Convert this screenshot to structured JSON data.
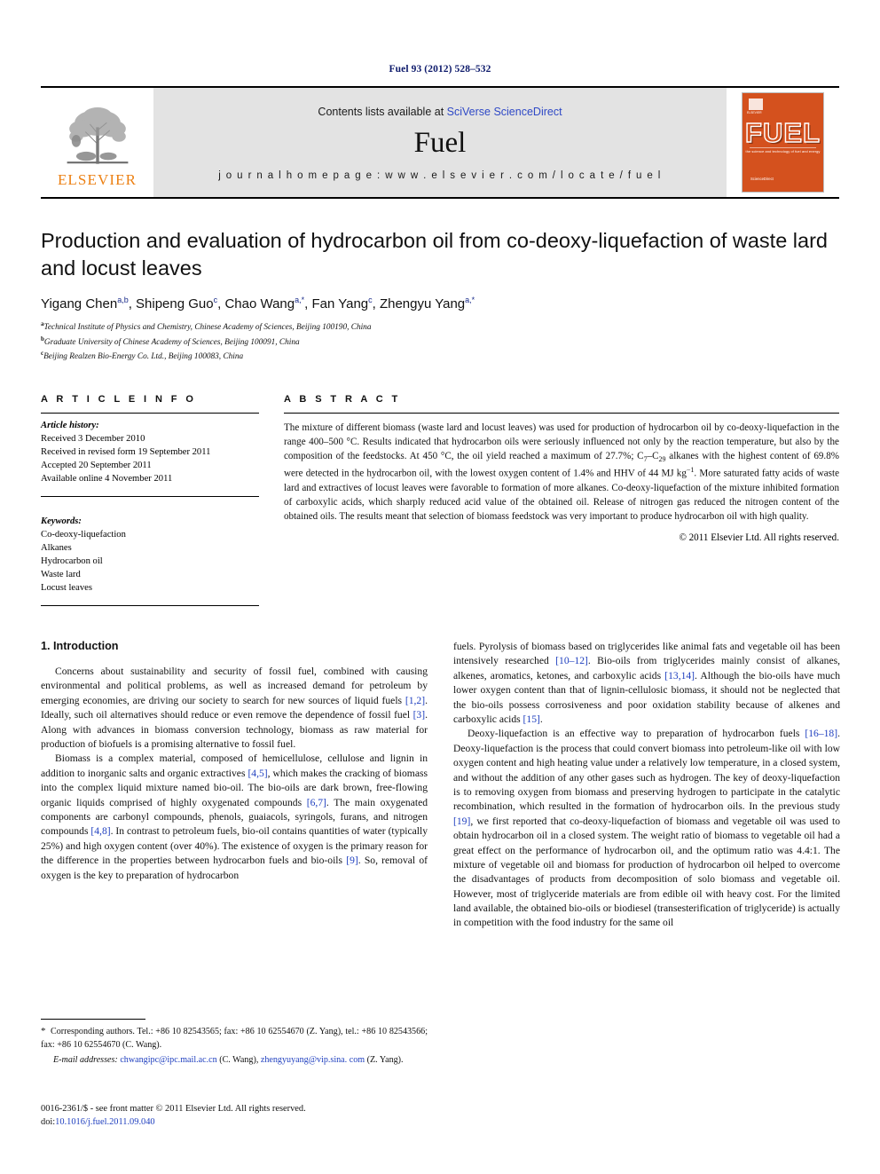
{
  "running_head": "Fuel 93 (2012) 528–532",
  "masthead": {
    "publisher_name": "ELSEVIER",
    "contents_prefix": "Contents lists available at ",
    "contents_link": "SciVerse ScienceDirect",
    "journal_name": "Fuel",
    "homepage": "j o u r n a l   h o m e p a g e :   w w w . e l s e v i e r . c o m / l o c a t e / f u e l",
    "cover": {
      "word": "FUEL",
      "subtitle": "the science and technology of fuel and energy",
      "footer": "ScienceDirect",
      "els_label": "ELSEVIER",
      "color": "#d4511e"
    }
  },
  "article": {
    "title": "Production and evaluation of hydrocarbon oil from co-deoxy-liquefaction of waste lard and locust leaves",
    "authors_html": "Yigang Chen<sup>a,b</sup>, Shipeng Guo<sup>c</sup>, Chao Wang<sup>a,*</sup>, Fan Yang<sup>c</sup>, Zhengyu Yang<sup>a,*</sup>",
    "affiliations": [
      {
        "marker": "a",
        "text": "Technical Institute of Physics and Chemistry, Chinese Academy of Sciences, Beijing 100190, China"
      },
      {
        "marker": "b",
        "text": "Graduate University of Chinese Academy of Sciences, Beijing 100091, China"
      },
      {
        "marker": "c",
        "text": "Beijing Realzen Bio-Energy Co. Ltd., Beijing 100083, China"
      }
    ]
  },
  "article_info": {
    "heading": "A R T I C L E   I N F O",
    "history_label": "Article history:",
    "history": [
      "Received 3 December 2010",
      "Received in revised form 19 September 2011",
      "Accepted 20 September 2011",
      "Available online 4 November 2011"
    ],
    "keywords_label": "Keywords:",
    "keywords": [
      "Co-deoxy-liquefaction",
      "Alkanes",
      "Hydrocarbon oil",
      "Waste lard",
      "Locust leaves"
    ]
  },
  "abstract": {
    "heading": "A B S T R A C T",
    "text_html": "The mixture of different biomass (waste lard and locust leaves) was used for production of hydrocarbon oil by co-deoxy-liquefaction in the range 400–500 °C. Results indicated that hydrocarbon oils were seriously influenced not only by the reaction temperature, but also by the composition of the feedstocks. At 450 °C, the oil yield reached a maximum of 27.7%; C<sub>7</sub>–C<sub>29</sub> alkanes with the highest content of 69.8% were detected in the hydrocarbon oil, with the lowest oxygen content of 1.4% and HHV of 44 MJ kg<sup>−1</sup>. More saturated fatty acids of waste lard and extractives of locust leaves were favorable to formation of more alkanes. Co-deoxy-liquefaction of the mixture inhibited formation of carboxylic acids, which sharply reduced acid value of the obtained oil. Release of nitrogen gas reduced the nitrogen content of the obtained oils. The results meant that selection of biomass feedstock was very important to produce hydrocarbon oil with high quality.",
    "copyright": "© 2011 Elsevier Ltd. All rights reserved."
  },
  "introduction": {
    "heading": "1. Introduction",
    "left_paragraphs_html": [
      "Concerns about sustainability and security of fossil fuel, combined with causing environmental and political problems, as well as increased demand for petroleum by emerging economies, are driving our society to search for new sources of liquid fuels <span class=\"ref\">[1,2]</span>. Ideally, such oil alternatives should reduce or even remove the dependence of fossil fuel <span class=\"ref\">[3]</span>. Along with advances in biomass conversion technology, biomass as raw material for production of biofuels is a promising alternative to fossil fuel.",
      "Biomass is a complex material, composed of hemicellulose, cellulose and lignin in addition to inorganic salts and organic extractives <span class=\"ref\">[4,5]</span>, which makes the cracking of biomass into the complex liquid mixture named bio-oil. The bio-oils are dark brown, free-flowing organic liquids comprised of highly oxygenated compounds <span class=\"ref\">[6,7]</span>. The main oxygenated components are carbonyl compounds, phenols, guaiacols, syringols, furans, and nitrogen compounds <span class=\"ref\">[4,8]</span>. In contrast to petroleum fuels, bio-oil contains quantities of water (typically 25%) and high oxygen content (over 40%). The existence of oxygen is the primary reason for the difference in the properties between hydrocarbon fuels and bio-oils <span class=\"ref\">[9]</span>. So, removal of oxygen is the key to preparation of hydrocarbon"
    ],
    "right_paragraphs_html": [
      "fuels. Pyrolysis of biomass based on triglycerides like animal fats and vegetable oil has been intensively researched <span class=\"ref\">[10–12]</span>. Bio-oils from triglycerides mainly consist of alkanes, alkenes, aromatics, ketones, and carboxylic acids <span class=\"ref\">[13,14]</span>. Although the bio-oils have much lower oxygen content than that of lignin-cellulosic biomass, it should not be neglected that the bio-oils possess corrosiveness and poor oxidation stability because of alkenes and carboxylic acids <span class=\"ref\">[15]</span>.",
      "Deoxy-liquefaction is an effective way to preparation of hydrocarbon fuels <span class=\"ref\">[16–18]</span>. Deoxy-liquefaction is the process that could convert biomass into petroleum-like oil with low oxygen content and high heating value under a relatively low temperature, in a closed system, and without the addition of any other gases such as hydrogen. The key of deoxy-liquefaction is to removing oxygen from biomass and preserving hydrogen to participate in the catalytic recombination, which resulted in the formation of hydrocarbon oils. In the previous study <span class=\"ref\">[19]</span>, we first reported that co-deoxy-liquefaction of biomass and vegetable oil was used to obtain hydrocarbon oil in a closed system. The weight ratio of biomass to vegetable oil had a great effect on the performance of hydrocarbon oil, and the optimum ratio was 4.4:1. The mixture of vegetable oil and biomass for production of hydrocarbon oil helped to overcome the disadvantages of products from decomposition of solo biomass and vegetable oil. However, most of triglyceride materials are from edible oil with heavy cost. For the limited land available, the obtained bio-oils or biodiesel (transesterification of triglyceride) is actually in competition with the food industry for the same oil"
    ]
  },
  "footnotes": {
    "corresponding_html": "<span class=\"star\">*</span>&nbsp; Corresponding authors. Tel.: +86 10 82543565; fax: +86 10 62554670 (Z. Yang), tel.: +86 10 82543566; fax: +86 10 62554670 (C. Wang).",
    "email_label": "E-mail addresses:",
    "email_html": "<span class=\"email-link\">chwangipc@ipc.mail.ac.cn</span> (C. Wang), <span class=\"email-link\">zhengyuyang@vip.sina. com</span> (Z. Yang)."
  },
  "footer": {
    "issn_line": "0016-2361/$ - see front matter © 2011 Elsevier Ltd. All rights reserved.",
    "doi_label": "doi:",
    "doi_value": "10.1016/j.fuel.2011.09.040"
  }
}
